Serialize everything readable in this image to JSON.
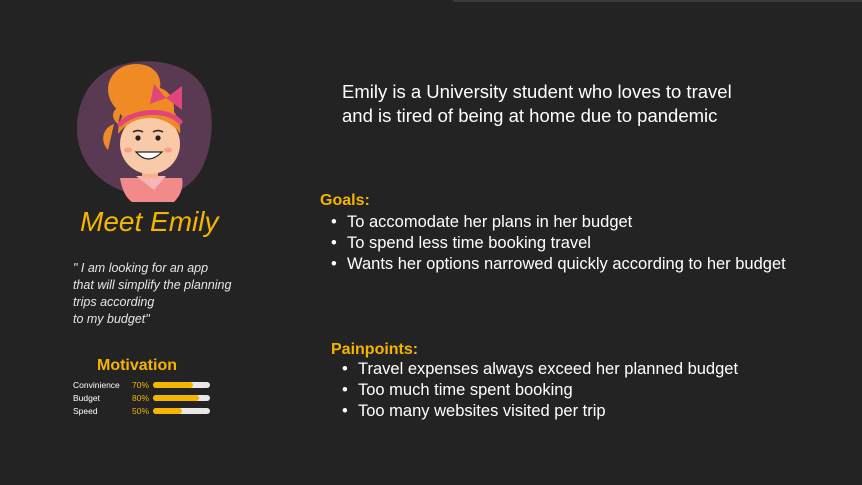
{
  "persona": {
    "meet_title": "Meet Emily",
    "quote": "\" I am looking for an app\nthat will simplify the  planning\ntrips according\nto my budget\"",
    "bio": "Emily is a  University student who loves to travel and is tired of being at home due to pandemic"
  },
  "motivation": {
    "title": "Motivation",
    "items": [
      {
        "name": "Convinience",
        "percent_label": "70%",
        "value": 0.7
      },
      {
        "name": "Budget",
        "percent_label": "80%",
        "value": 0.8
      },
      {
        "name": "Speed",
        "percent_label": "50%",
        "value": 0.5
      }
    ]
  },
  "goals": {
    "title": "Goals:",
    "items": [
      "To accomodate her plans in her budget",
      "To spend less time booking travel",
      "Wants her options narrowed quickly according to her budget"
    ]
  },
  "painpoints": {
    "title": "Painpoints:",
    "items": [
      "Travel expenses always exceed her planned budget",
      "Too much time spent booking",
      "Too many websites visited per trip"
    ]
  },
  "colors": {
    "background": "#232323",
    "accent": "#f4b400",
    "bar_track": "#e8e8e8",
    "blob": "#5a3a52"
  }
}
